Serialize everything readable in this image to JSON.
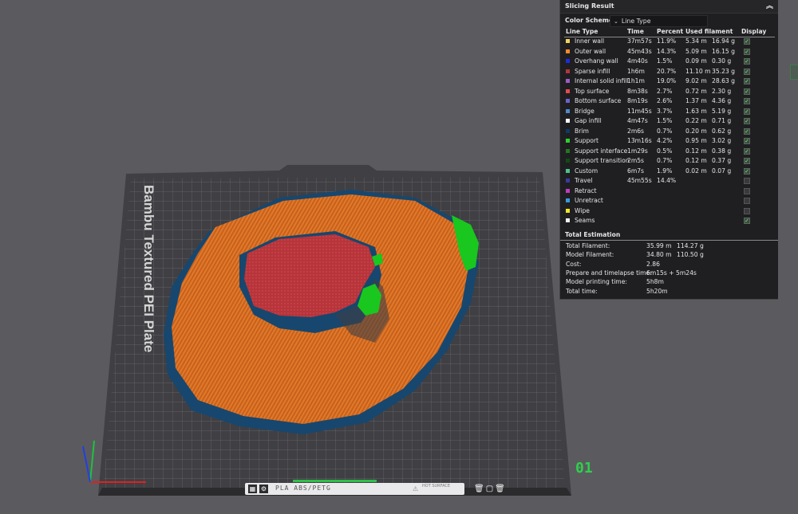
{
  "plate": {
    "label": "Bambu Textured PEI Plate",
    "number": "01",
    "filament": "PLA ABS/PETG",
    "surface": "HOT SURFACE"
  },
  "panel": {
    "title": "Slicing Result",
    "color_scheme_label": "Color Scheme",
    "color_scheme_value": "Line Type",
    "headers": [
      "Line Type",
      "Time",
      "Percent",
      "Used filament",
      "Display"
    ],
    "rows": [
      {
        "name": "Inner wall",
        "time": "37m57s",
        "pct": "11.9%",
        "len": "5.34 m",
        "g": "16.94 g",
        "color": "#f2d35b",
        "on": true
      },
      {
        "name": "Outer wall",
        "time": "45m43s",
        "pct": "14.3%",
        "len": "5.09 m",
        "g": "16.15 g",
        "color": "#ff8a26",
        "on": true
      },
      {
        "name": "Overhang wall",
        "time": "4m40s",
        "pct": "1.5%",
        "len": "0.09 m",
        "g": "0.30 g",
        "color": "#1d2ddd",
        "on": true
      },
      {
        "name": "Sparse infill",
        "time": "1h6m",
        "pct": "20.7%",
        "len": "11.10 m",
        "g": "35.23 g",
        "color": "#b3363a",
        "on": true
      },
      {
        "name": "Internal solid infill",
        "time": "1h1m",
        "pct": "19.0%",
        "len": "9.02 m",
        "g": "28.63 g",
        "color": "#9b5cc5",
        "on": true
      },
      {
        "name": "Top surface",
        "time": "8m38s",
        "pct": "2.7%",
        "len": "0.72 m",
        "g": "2.30 g",
        "color": "#e44a4a",
        "on": true
      },
      {
        "name": "Bottom surface",
        "time": "8m19s",
        "pct": "2.6%",
        "len": "1.37 m",
        "g": "4.36 g",
        "color": "#6b63c9",
        "on": true
      },
      {
        "name": "Bridge",
        "time": "11m45s",
        "pct": "3.7%",
        "len": "1.63 m",
        "g": "5.19 g",
        "color": "#4f8ac8",
        "on": true
      },
      {
        "name": "Gap infill",
        "time": "4m47s",
        "pct": "1.5%",
        "len": "0.22 m",
        "g": "0.71 g",
        "color": "#ffffff",
        "on": true
      },
      {
        "name": "Brim",
        "time": "2m6s",
        "pct": "0.7%",
        "len": "0.20 m",
        "g": "0.62 g",
        "color": "#0d3b66",
        "on": true
      },
      {
        "name": "Support",
        "time": "13m16s",
        "pct": "4.2%",
        "len": "0.95 m",
        "g": "3.02 g",
        "color": "#2bd12b",
        "on": true
      },
      {
        "name": "Support interface",
        "time": "1m29s",
        "pct": "0.5%",
        "len": "0.12 m",
        "g": "0.38 g",
        "color": "#1e7a1e",
        "on": true
      },
      {
        "name": "Support transition",
        "time": "2m5s",
        "pct": "0.7%",
        "len": "0.12 m",
        "g": "0.37 g",
        "color": "#0f4d0f",
        "on": true
      },
      {
        "name": "Custom",
        "time": "6m7s",
        "pct": "1.9%",
        "len": "0.02 m",
        "g": "0.07 g",
        "color": "#4fbf8f",
        "on": true
      },
      {
        "name": "Travel",
        "time": "45m55s",
        "pct": "14.4%",
        "len": "",
        "g": "",
        "color": "#3a3aa0",
        "on": false
      },
      {
        "name": "Retract",
        "time": "",
        "pct": "",
        "len": "",
        "g": "",
        "color": "#c03ac0",
        "on": false
      },
      {
        "name": "Unretract",
        "time": "",
        "pct": "",
        "len": "",
        "g": "",
        "color": "#3a9ad9",
        "on": false
      },
      {
        "name": "Wipe",
        "time": "",
        "pct": "",
        "len": "",
        "g": "",
        "color": "#f5e51e",
        "on": false
      },
      {
        "name": "Seams",
        "time": "",
        "pct": "",
        "len": "",
        "g": "",
        "color": "#f0f0f0",
        "on": true
      }
    ],
    "total_title": "Total Estimation",
    "totals": [
      {
        "label": "Total Filament:",
        "v1": "35.99 m",
        "v2": "114.27 g"
      },
      {
        "label": "Model Filament:",
        "v1": "34.80 m",
        "v2": "110.50 g"
      },
      {
        "label": "Cost:",
        "v1": "2.86",
        "v2": ""
      },
      {
        "label": "Prepare and timelapse time:",
        "v1": "6m15s + 5m24s",
        "v2": ""
      },
      {
        "label": "Model printing time:",
        "v1": "5h8m",
        "v2": ""
      },
      {
        "label": "Total time:",
        "v1": "5h20m",
        "v2": ""
      }
    ]
  }
}
